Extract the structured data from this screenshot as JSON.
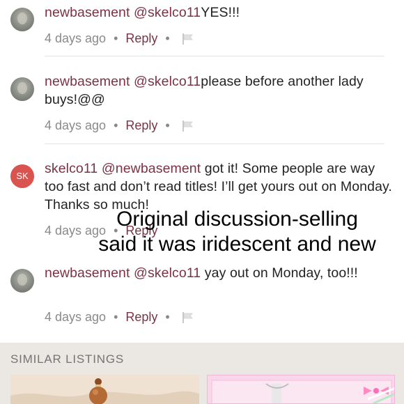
{
  "comments": [
    {
      "avatar": {
        "type": "photo",
        "icon": "user-photo-avatar"
      },
      "username": "newbasement",
      "mention": "@skelco11",
      "body": "YES!!!",
      "time": "4 days ago",
      "reply_label": "Reply",
      "flag_icon": "flag-icon"
    },
    {
      "avatar": {
        "type": "photo",
        "icon": "user-photo-avatar"
      },
      "username": "newbasement",
      "mention": "@skelco11",
      "body": "please before another lady buys!@@",
      "time": "4 days ago",
      "reply_label": "Reply",
      "flag_icon": "flag-icon"
    },
    {
      "avatar": {
        "type": "initials",
        "initials": "SK",
        "color": "#d9534f"
      },
      "username": "skelco11",
      "mention": "@newbasement",
      "body": "got it! Some people are way too fast and don’t read titles! I’ll get yours out on Monday. Thanks so much!",
      "time": "4 days ago",
      "reply_label": "Reply"
    },
    {
      "avatar": {
        "type": "photo",
        "icon": "user-photo-avatar"
      },
      "username": "newbasement",
      "mention": "@skelco11",
      "body": "yay out on Monday, too!!!",
      "time": "4 days ago",
      "reply_label": "Reply",
      "flag_icon": "flag-icon"
    }
  ],
  "overlay_text": "Original discussion-selling said it was iridescent and new",
  "similar_listings": {
    "title": "SIMILAR LISTINGS",
    "items": [
      {
        "icon": "bracelet-thumbnail"
      },
      {
        "icon": "bow-thumbnail"
      }
    ]
  },
  "colors": {
    "username": "#7b3244",
    "reply": "#7b3244",
    "meta": "#8a8a8a",
    "avatar_initials_bg": "#d9534f",
    "similar_bg": "#ebe7e2"
  }
}
